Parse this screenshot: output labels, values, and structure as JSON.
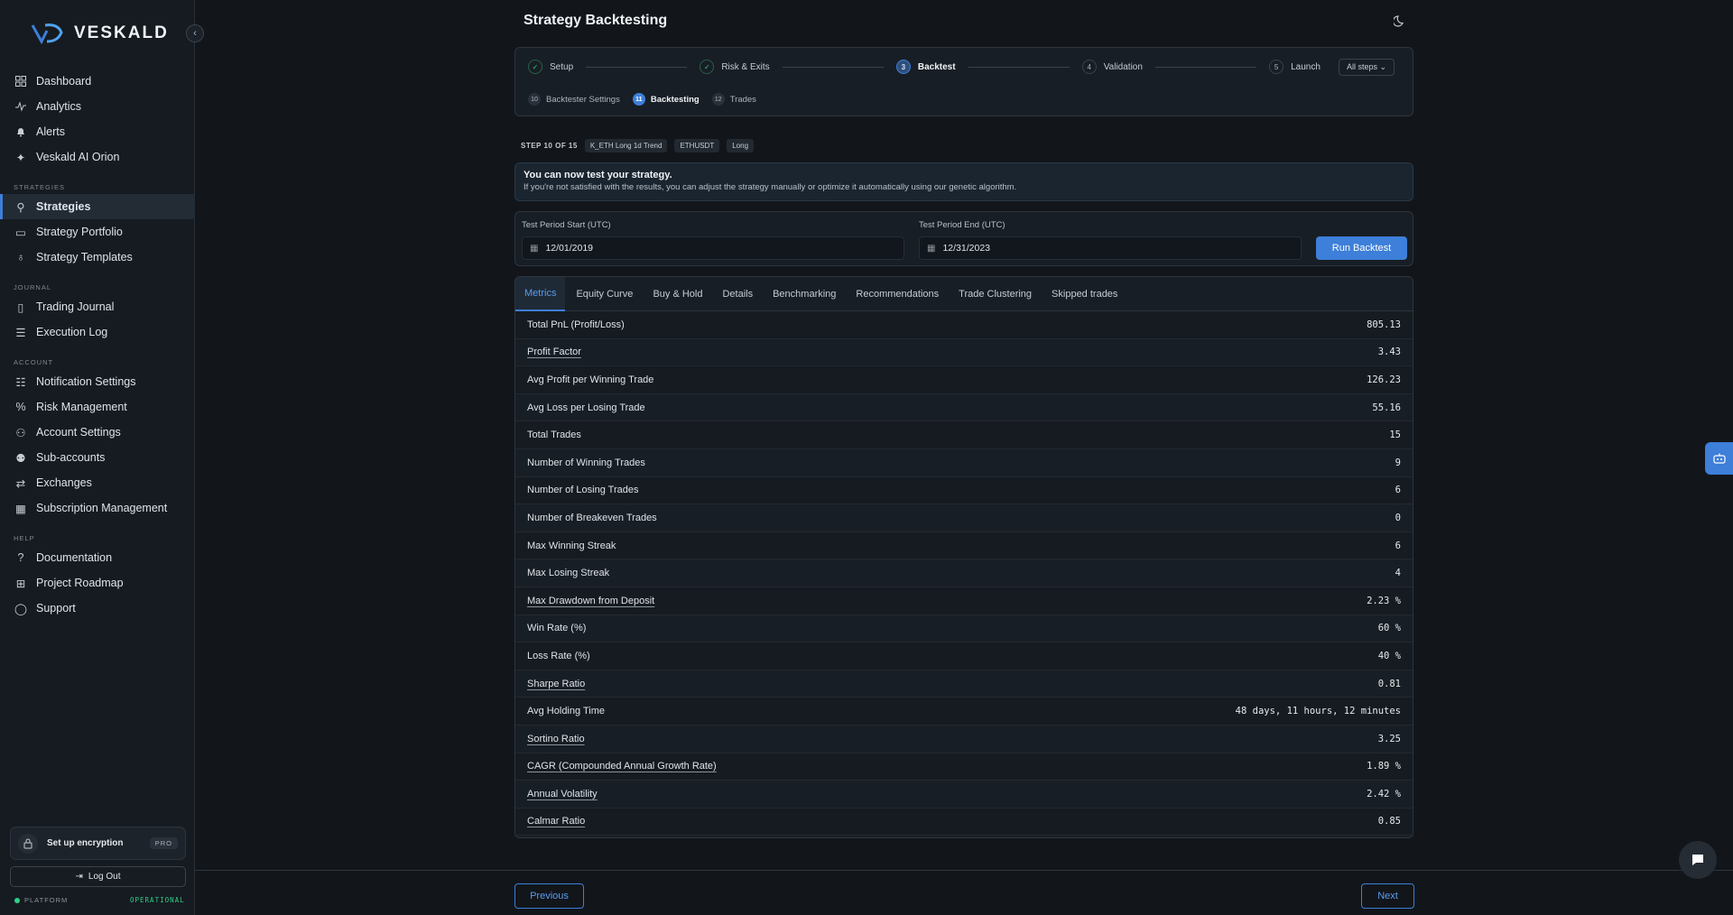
{
  "brand": {
    "name": "VESKALD",
    "accent": "#3d7fd9"
  },
  "sidebar": {
    "items_main": [
      {
        "label": "Dashboard",
        "icon": "dashboard-icon"
      },
      {
        "label": "Analytics",
        "icon": "analytics-icon"
      },
      {
        "label": "Alerts",
        "icon": "bell-icon"
      },
      {
        "label": "Veskald AI Orion",
        "icon": "ai-icon"
      }
    ],
    "section_strategies": "STRATEGIES",
    "items_strategies": [
      {
        "label": "Strategies",
        "icon": "strategies-icon"
      },
      {
        "label": "Strategy Portfolio",
        "icon": "briefcase-icon"
      },
      {
        "label": "Strategy Templates",
        "icon": "bulb-icon"
      }
    ],
    "section_journal": "JOURNAL",
    "items_journal": [
      {
        "label": "Trading Journal",
        "icon": "book-icon"
      },
      {
        "label": "Execution Log",
        "icon": "list-icon"
      }
    ],
    "section_account": "ACCOUNT",
    "items_account": [
      {
        "label": "Notification Settings",
        "icon": "sliders-icon"
      },
      {
        "label": "Risk Management",
        "icon": "percent-icon"
      },
      {
        "label": "Account Settings",
        "icon": "user-gear-icon"
      },
      {
        "label": "Sub-accounts",
        "icon": "users-icon"
      },
      {
        "label": "Exchanges",
        "icon": "exchange-icon"
      },
      {
        "label": "Subscription Management",
        "icon": "calendar-icon"
      }
    ],
    "section_help": "HELP",
    "items_help": [
      {
        "label": "Documentation",
        "icon": "help-circle-icon"
      },
      {
        "label": "Project Roadmap",
        "icon": "map-icon"
      },
      {
        "label": "Support",
        "icon": "chat-icon"
      }
    ],
    "encryption_label": "Set up encryption",
    "pro_badge": "PRO",
    "logout": "Log Out",
    "platform_label": "PLATFORM",
    "platform_status": "OPERATIONAL"
  },
  "page": {
    "title": "Strategy Backtesting"
  },
  "stepper": {
    "steps": [
      {
        "num": "✓",
        "label": "Setup",
        "state": "done"
      },
      {
        "num": "✓",
        "label": "Risk & Exits",
        "state": "done"
      },
      {
        "num": "3",
        "label": "Backtest",
        "state": "current"
      },
      {
        "num": "4",
        "label": "Validation",
        "state": "todo"
      },
      {
        "num": "5",
        "label": "Launch",
        "state": "todo"
      }
    ],
    "all_steps": "All steps",
    "substeps": [
      {
        "num": "10",
        "label": "Backtester Settings",
        "active": false
      },
      {
        "num": "11",
        "label": "Backtesting",
        "active": true
      },
      {
        "num": "12",
        "label": "Trades",
        "active": false
      }
    ]
  },
  "step_info": {
    "label": "STEP 10 OF 15",
    "chips": [
      "K_ETH Long 1d Trend",
      "ETHUSDT",
      "Long"
    ]
  },
  "banner": {
    "title": "You can now test your strategy.",
    "text": "If you're not satisfied with the results, you can adjust the strategy manually or optimize it automatically using our genetic algorithm."
  },
  "period": {
    "start_label": "Test Period Start (UTC)",
    "start_value": "12/01/2019",
    "end_label": "Test Period End (UTC)",
    "end_value": "12/31/2023",
    "run_button": "Run Backtest"
  },
  "tabs": [
    "Metrics",
    "Equity Curve",
    "Buy & Hold",
    "Details",
    "Benchmarking",
    "Recommendations",
    "Trade Clustering",
    "Skipped trades"
  ],
  "metrics": [
    {
      "label": "Total PnL (Profit/Loss)",
      "value": "805.13",
      "u": false
    },
    {
      "label": "Profit Factor",
      "value": "3.43",
      "u": true
    },
    {
      "label": "Avg Profit per Winning Trade",
      "value": "126.23",
      "u": false
    },
    {
      "label": "Avg Loss per Losing Trade",
      "value": "55.16",
      "u": false
    },
    {
      "label": "Total Trades",
      "value": "15",
      "u": false
    },
    {
      "label": "Number of Winning Trades",
      "value": "9",
      "u": false
    },
    {
      "label": "Number of Losing Trades",
      "value": "6",
      "u": false
    },
    {
      "label": "Number of Breakeven Trades",
      "value": "0",
      "u": false
    },
    {
      "label": "Max Winning Streak",
      "value": "6",
      "u": false
    },
    {
      "label": "Max Losing Streak",
      "value": "4",
      "u": false
    },
    {
      "label": "Max Drawdown from Deposit",
      "value": "2.23 %",
      "u": true
    },
    {
      "label": "Win Rate (%)",
      "value": "60 %",
      "u": false
    },
    {
      "label": "Loss Rate (%)",
      "value": "40 %",
      "u": false
    },
    {
      "label": "Sharpe Ratio",
      "value": "0.81",
      "u": true
    },
    {
      "label": "Avg Holding Time",
      "value": "48 days, 11 hours, 12 minutes",
      "u": false
    },
    {
      "label": "Sortino Ratio",
      "value": "3.25",
      "u": true
    },
    {
      "label": "CAGR (Compounded Annual Growth Rate)",
      "value": "1.89 %",
      "u": true
    },
    {
      "label": "Annual Volatility",
      "value": "2.42 %",
      "u": true
    },
    {
      "label": "Calmar Ratio",
      "value": "0.85",
      "u": true
    }
  ],
  "nav_buttons": {
    "previous": "Previous",
    "next": "Next"
  }
}
